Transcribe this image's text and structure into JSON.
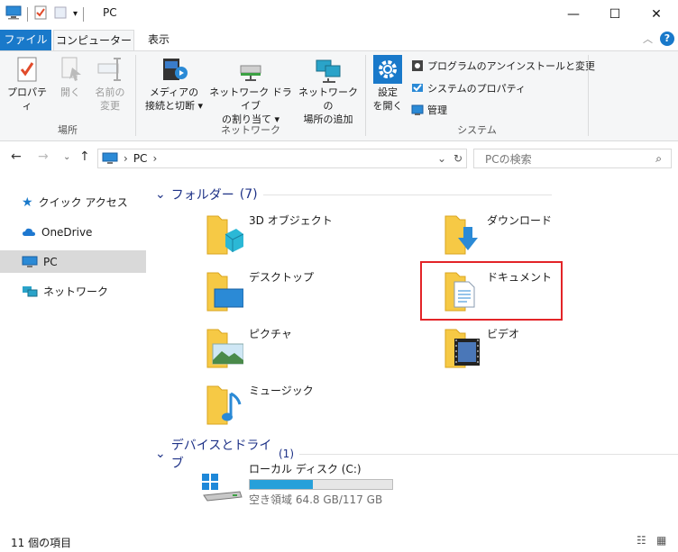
{
  "window": {
    "title": "PC"
  },
  "tabs": {
    "file": "ファイル",
    "computer": "コンピューター",
    "view": "表示"
  },
  "ribbon": {
    "location": {
      "label": "場所",
      "properties": "プロパティ",
      "open": "開く",
      "rename_1": "名前の",
      "rename_2": "変更"
    },
    "network": {
      "label": "ネットワーク",
      "media_1": "メディアの",
      "media_2": "接続と切断",
      "map_1": "ネットワーク ドライブ",
      "map_2": "の割り当て",
      "addloc_1": "ネットワークの",
      "addloc_2": "場所の追加"
    },
    "system": {
      "label": "システム",
      "settings_1": "設定",
      "settings_2": "を開く",
      "uninstall": "プログラムのアンインストールと変更",
      "sysprops": "システムのプロパティ",
      "manage": "管理"
    }
  },
  "address": {
    "crumb": "PC",
    "search_placeholder": "PCの検索"
  },
  "nav": {
    "quick": "クイック アクセス",
    "onedrive": "OneDrive",
    "pc": "PC",
    "network": "ネットワーク"
  },
  "folders": {
    "header": "フォルダー",
    "count": "(7)",
    "items": [
      "3D オブジェクト",
      "ダウンロード",
      "デスクトップ",
      "ドキュメント",
      "ピクチャ",
      "ビデオ",
      "ミュージック"
    ]
  },
  "devices": {
    "header": "デバイスとドライブ",
    "count": "(1)",
    "drive_name": "ローカル ディスク (C:)",
    "free_text": "空き領域 64.8 GB/117 GB",
    "used_fraction": 0.446
  },
  "status": {
    "items": "11 個の項目"
  },
  "colors": {
    "accent": "#1979ca",
    "highlight": "#e32428",
    "folder": "#f6c945"
  }
}
